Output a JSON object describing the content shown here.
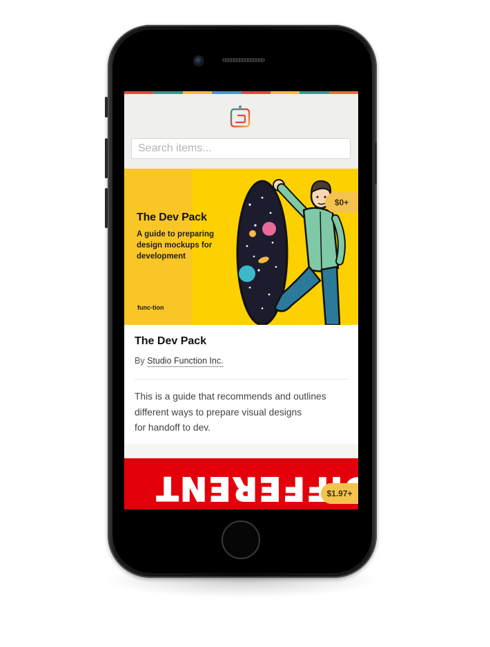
{
  "brand_colors": [
    "#e8453c",
    "#2a9d8f",
    "#f4b942",
    "#4a90d9",
    "#e8453c",
    "#f4b942",
    "#2a9d8f",
    "#e86a3c"
  ],
  "app": {
    "logo_icon": "function-logo-icon",
    "search": {
      "placeholder": "Search items..."
    }
  },
  "product": {
    "cover_title": "The Dev Pack",
    "cover_subtitle": "A guide to preparing design mockups for development",
    "cover_brand": "func-tion",
    "price": "$0+",
    "title": "The Dev Pack",
    "author_prefix": "By",
    "author": "Studio Function Inc.",
    "description_lines": [
      "This is a guide that recommends and outlines",
      "different ways to prepare visual designs",
      "for handoff to dev."
    ]
  },
  "next_product": {
    "cover_word": "DIFFERENT",
    "price": "$1.97+"
  }
}
